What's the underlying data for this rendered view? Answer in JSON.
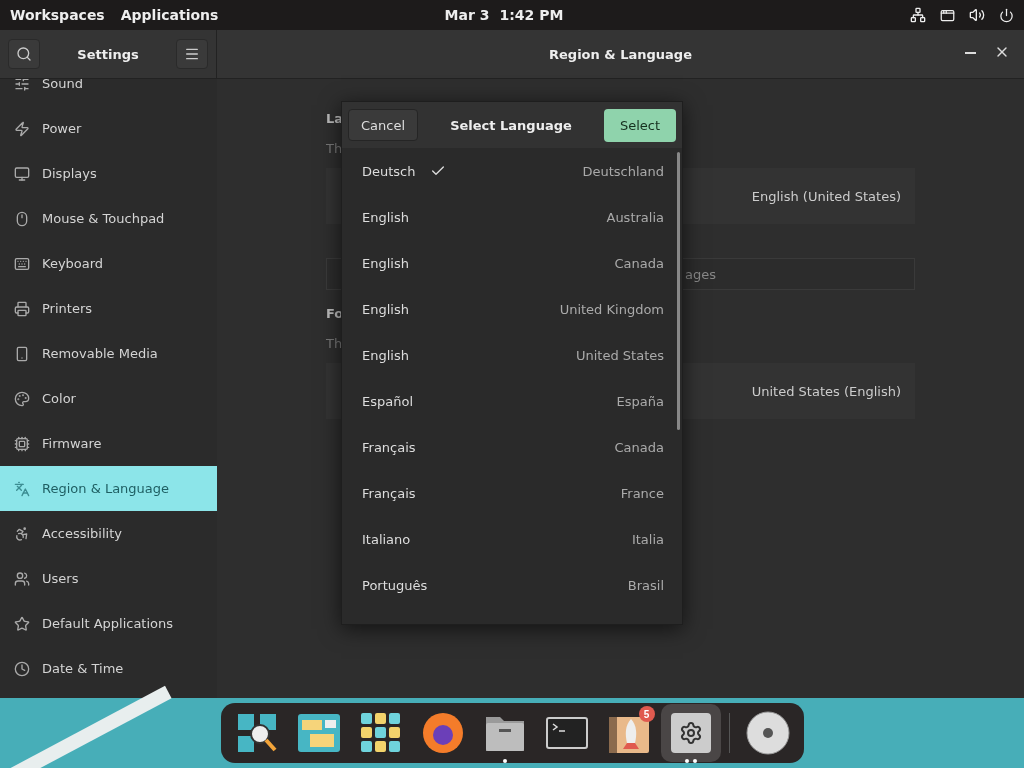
{
  "top_bar": {
    "left": [
      "Workspaces",
      "Applications"
    ],
    "date": "Mar 3",
    "time": "1:42 PM"
  },
  "window": {
    "sidebar_title": "Settings",
    "title": "Region & Language"
  },
  "sidebar": {
    "items": [
      {
        "label": "Sound",
        "selected": false
      },
      {
        "label": "Power",
        "selected": false
      },
      {
        "label": "Displays",
        "selected": false
      },
      {
        "label": "Mouse & Touchpad",
        "selected": false
      },
      {
        "label": "Keyboard",
        "selected": false
      },
      {
        "label": "Printers",
        "selected": false
      },
      {
        "label": "Removable Media",
        "selected": false
      },
      {
        "label": "Color",
        "selected": false
      },
      {
        "label": "Firmware",
        "selected": false
      },
      {
        "label": "Region & Language",
        "selected": true
      },
      {
        "label": "Accessibility",
        "selected": false
      },
      {
        "label": "Users",
        "selected": false
      },
      {
        "label": "Default Applications",
        "selected": false
      },
      {
        "label": "Date & Time",
        "selected": false
      }
    ]
  },
  "content": {
    "language_heading": "La",
    "language_desc": "Th",
    "language_value": "English (United States)",
    "search_placeholder": "ages",
    "formats_heading": "Fo",
    "formats_desc": "Th",
    "formats_value": "United States (English)"
  },
  "dialog": {
    "title": "Select Language",
    "cancel": "Cancel",
    "select": "Select",
    "items": [
      {
        "language": "Deutsch",
        "region": "Deutschland",
        "selected": true
      },
      {
        "language": "English",
        "region": "Australia",
        "selected": false
      },
      {
        "language": "English",
        "region": "Canada",
        "selected": false
      },
      {
        "language": "English",
        "region": "United Kingdom",
        "selected": false
      },
      {
        "language": "English",
        "region": "United States",
        "selected": false
      },
      {
        "language": "Español",
        "region": "España",
        "selected": false
      },
      {
        "language": "Français",
        "region": "Canada",
        "selected": false
      },
      {
        "language": "Français",
        "region": "France",
        "selected": false
      },
      {
        "language": "Italiano",
        "region": "Italia",
        "selected": false
      },
      {
        "language": "Português",
        "region": "Brasil",
        "selected": false
      }
    ]
  },
  "dock": [
    {
      "kind": "search",
      "running": false,
      "focused": false
    },
    {
      "kind": "windows",
      "running": false,
      "focused": false
    },
    {
      "kind": "grid",
      "running": false,
      "focused": false
    },
    {
      "kind": "browser",
      "running": false,
      "focused": false
    },
    {
      "kind": "folder",
      "running": true,
      "focused": false
    },
    {
      "kind": "terminal",
      "running": false,
      "focused": false
    },
    {
      "kind": "store",
      "running": false,
      "focused": false,
      "badge": "5"
    },
    {
      "kind": "gear",
      "running": true,
      "focused": true
    },
    {
      "kind": "disc",
      "running": false,
      "focused": false
    }
  ]
}
